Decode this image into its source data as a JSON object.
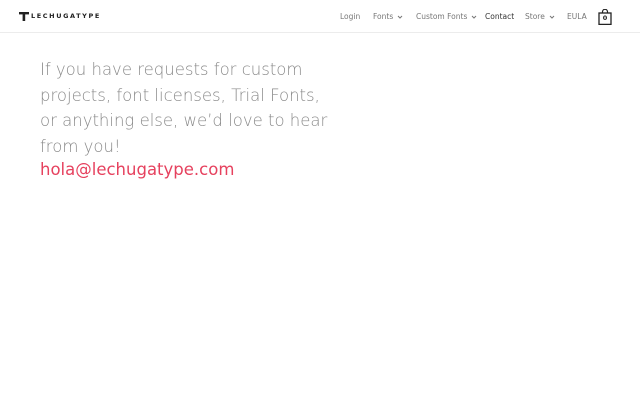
{
  "header": {
    "brand": "LECHUGATYPE",
    "nav": [
      {
        "label": "Login"
      },
      {
        "label": "Fonts",
        "has_dropdown": true
      },
      {
        "label": "Custom Fonts",
        "has_dropdown": true
      },
      {
        "label": "Contact",
        "active": true
      },
      {
        "label": "Store",
        "has_dropdown": true
      },
      {
        "label": "EULA"
      }
    ],
    "cart_count": "0"
  },
  "main": {
    "message": "If you have requests for custom projects, font licenses, Trial Fonts, or anything else, we’d love to hear from you!",
    "email": "hola@lechugatype.com"
  },
  "colors": {
    "accent": "#e6415e",
    "text": "#8a8a8a",
    "nav_text": "#777777",
    "nav_active": "#333333"
  }
}
